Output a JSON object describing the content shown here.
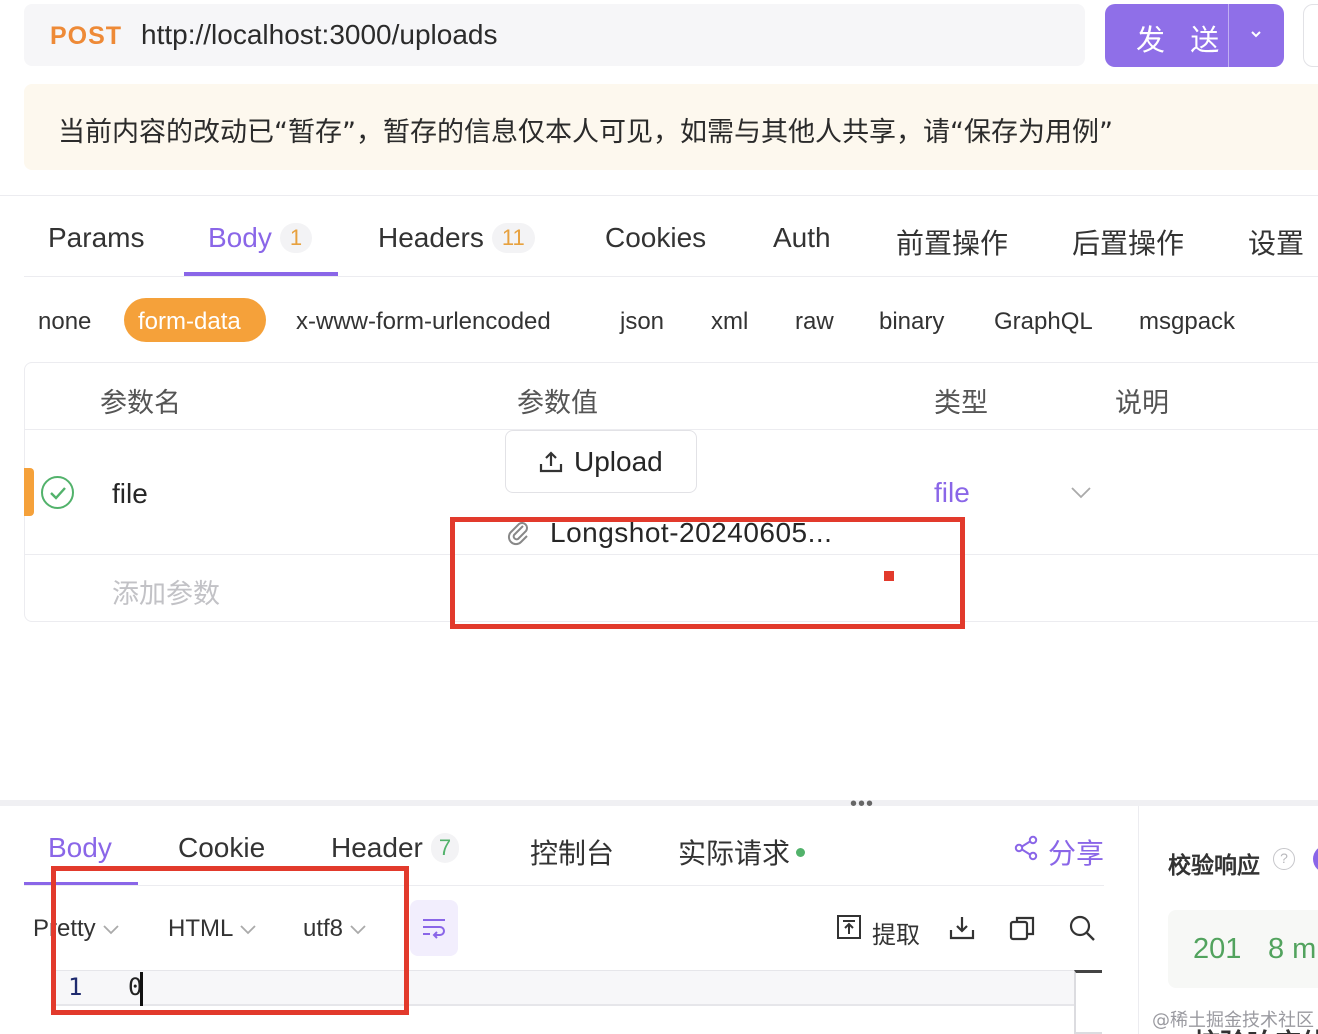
{
  "request": {
    "method": "POST",
    "url": "http://localhost:3000/uploads",
    "send_label": "发 送"
  },
  "notice": "当前内容的改动已“暂存”，暂存的信息仅本人可见，如需与其他人共享，请“保存为用例”",
  "request_tabs": [
    {
      "label": "Params"
    },
    {
      "label": "Body",
      "badge": "1"
    },
    {
      "label": "Headers",
      "badge": "11"
    },
    {
      "label": "Cookies"
    },
    {
      "label": "Auth"
    },
    {
      "label": "前置操作"
    },
    {
      "label": "后置操作"
    },
    {
      "label": "设置"
    }
  ],
  "body_types": [
    "none",
    "form-data",
    "x-www-form-urlencoded",
    "json",
    "xml",
    "raw",
    "binary",
    "GraphQL",
    "msgpack"
  ],
  "params_table": {
    "headers": [
      "参数名",
      "参数值",
      "类型",
      "说明"
    ],
    "rows": [
      {
        "name": "file",
        "upload_label": "Upload",
        "file_name": "Longshot-20240605...",
        "type": "file"
      }
    ],
    "add_placeholder": "添加参数"
  },
  "response_tabs": [
    {
      "label": "Body"
    },
    {
      "label": "Cookie"
    },
    {
      "label": "Header",
      "badge": "7"
    },
    {
      "label": "控制台"
    },
    {
      "label": "实际请求"
    }
  ],
  "share_label": "分享",
  "response_toolbar": {
    "format": "Pretty",
    "lang": "HTML",
    "encoding": "utf8",
    "extract_label": "提取"
  },
  "code": {
    "line_no": "1",
    "text": "0"
  },
  "validation": {
    "title": "校验响应",
    "status": "201",
    "time": "8 m",
    "cut_text": "校验响应体"
  },
  "watermark": "@稀土掘金技术社区",
  "colors": {
    "accent": "#8a66e8",
    "method": "#ee8a37",
    "pill": "#f5a13a",
    "success": "#52b26b",
    "annotation": "#e23a2c"
  }
}
